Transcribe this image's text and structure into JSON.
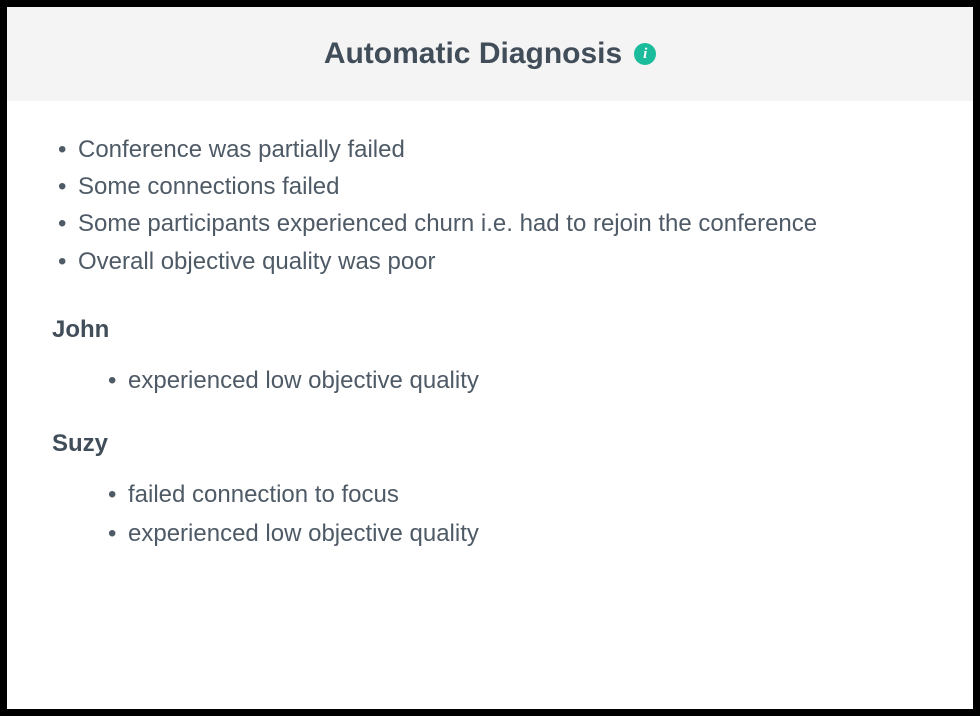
{
  "header": {
    "title": "Automatic Diagnosis",
    "info_icon": "i"
  },
  "summary": [
    "Conference was partially failed",
    "Some connections failed",
    "Some participants experienced churn i.e. had to rejoin the conference",
    "Overall objective quality was poor"
  ],
  "participants": [
    {
      "name": "John",
      "issues": [
        "experienced low objective quality"
      ]
    },
    {
      "name": "Suzy",
      "issues": [
        "failed connection to focus",
        "experienced low objective quality"
      ]
    }
  ]
}
